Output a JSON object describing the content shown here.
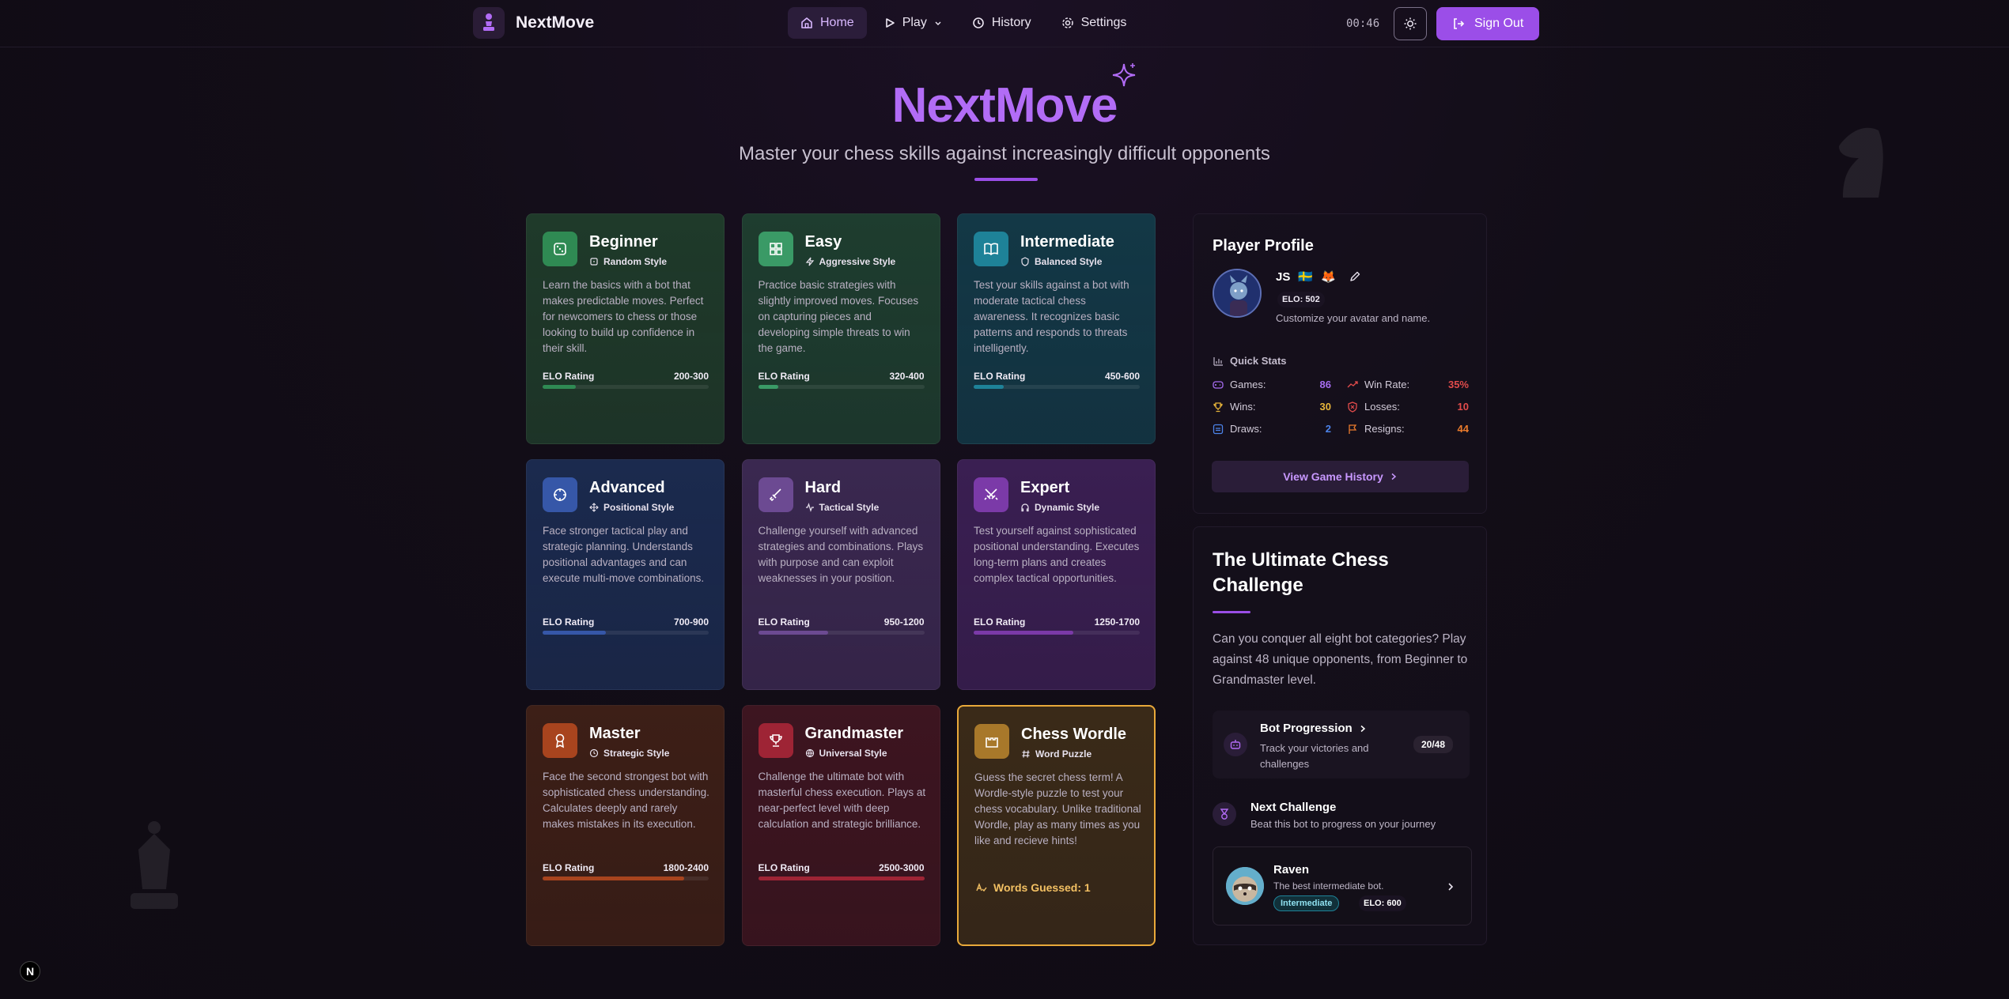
{
  "nav": {
    "brand": "NextMove",
    "links": [
      {
        "label": "Home",
        "active": true
      },
      {
        "label": "Play",
        "has_dropdown": true
      },
      {
        "label": "History"
      },
      {
        "label": "Settings"
      }
    ],
    "timer": "00:46",
    "theme_icon": "sun-icon",
    "signout_label": "Sign Out"
  },
  "hero": {
    "title": "NextMove",
    "subtitle": "Master your chess skills against increasingly difficult opponents"
  },
  "elo_label": "ELO Rating",
  "cards": [
    {
      "title": "Beginner",
      "style": "Random Style",
      "icon": "dice-icon",
      "style_icon": "dice-small-icon",
      "description": "Learn the basics with a bot that makes predictable moves. Perfect for newcomers to chess or those looking to build up confidence in their skill.",
      "elo": "200-300",
      "progress": 0.2,
      "color": "#1f3a2a",
      "accent": "#2f8a53"
    },
    {
      "title": "Easy",
      "style": "Aggressive Style",
      "icon": "blocks-icon",
      "style_icon": "zap-icon",
      "description": "Practice basic strategies with slightly improved moves. Focuses on capturing pieces and developing simple threats to win the game.",
      "elo": "320-400",
      "progress": 0.12,
      "color": "#1e3d2f",
      "accent": "#3a9a66"
    },
    {
      "title": "Intermediate",
      "style": "Balanced Style",
      "icon": "book-icon",
      "style_icon": "shield-icon",
      "description": "Test your skills against a bot with moderate tactical chess awareness. It recognizes basic patterns and responds to threats intelligently.",
      "elo": "450-600",
      "progress": 0.18,
      "color": "#133846",
      "accent": "#1e8298"
    },
    {
      "title": "Advanced",
      "style": "Positional Style",
      "icon": "crosshair-icon",
      "style_icon": "move-icon",
      "description": "Face stronger tactical play and strategic planning. Understands positional advantages and can execute multi-move combinations.",
      "elo": "700-900",
      "progress": 0.38,
      "color": "#1b2a4e",
      "accent": "#3657a8"
    },
    {
      "title": "Hard",
      "style": "Tactical Style",
      "icon": "sword-icon",
      "style_icon": "activity-icon",
      "description": "Challenge yourself with advanced strategies and combinations. Plays with purpose and can exploit weaknesses in your position.",
      "elo": "950-1200",
      "progress": 0.42,
      "color": "#3a2850",
      "accent": "#6c4a92"
    },
    {
      "title": "Expert",
      "style": "Dynamic Style",
      "icon": "swords-icon",
      "style_icon": "headphones-icon",
      "description": "Test yourself against sophisticated positional understanding. Executes long-term plans and creates complex tactical opportunities.",
      "elo": "1250-1700",
      "progress": 0.6,
      "color": "#3a1f52",
      "accent": "#7b3aa8"
    },
    {
      "title": "Master",
      "style": "Strategic Style",
      "icon": "award-icon",
      "style_icon": "clock-icon",
      "description": "Face the second strongest bot with sophisticated chess understanding. Calculates deeply and rarely makes mistakes in its execution.",
      "elo": "1800-2400",
      "progress": 0.85,
      "color": "#3d1f17",
      "accent": "#a8441e"
    },
    {
      "title": "Grandmaster",
      "style": "Universal Style",
      "icon": "trophy-icon",
      "style_icon": "globe-icon",
      "description": "Challenge the ultimate bot with masterful chess execution. Plays at near-perfect level with deep calculation and strategic brilliance.",
      "elo": "2500-3000",
      "progress": 1.0,
      "color": "#3d1520",
      "accent": "#9e2435"
    },
    {
      "title": "Chess Wordle",
      "style": "Word Puzzle",
      "icon": "castle-icon",
      "style_icon": "hash-icon",
      "description": "Guess the secret chess term! A Wordle-style puzzle to test your chess vocabulary. Unlike traditional Wordle, play as many times as you like and recieve hints!",
      "words_guessed": "Words Guessed: 1",
      "color": "#3a2a18",
      "accent": "#a8782a"
    }
  ],
  "profile": {
    "heading": "Player Profile",
    "name": "JS",
    "flag": "🇸🇪",
    "emoji": "🦊",
    "elo": "ELO: 502",
    "caption": "Customize your avatar and name.",
    "quick_stats_label": "Quick Stats",
    "stats": [
      {
        "label": "Games:",
        "value": "86",
        "icon": "gamepad-icon",
        "color": "#a66cf0"
      },
      {
        "label": "Win Rate:",
        "value": "35%",
        "icon": "trending-up-icon",
        "color": "#e14b4b"
      },
      {
        "label": "Wins:",
        "value": "30",
        "icon": "trophy-icon",
        "color": "#e8b53a"
      },
      {
        "label": "Losses:",
        "value": "10",
        "icon": "shield-x-icon",
        "color": "#e14b4b"
      },
      {
        "label": "Draws:",
        "value": "2",
        "icon": "equal-icon",
        "color": "#4c83ea"
      },
      {
        "label": "Resigns:",
        "value": "44",
        "icon": "flag-icon",
        "color": "#ea7b2c"
      }
    ],
    "history_button": "View Game History"
  },
  "challenge": {
    "title": "The Ultimate Chess Challenge",
    "description": "Can you conquer all eight bot categories? Play against 48 unique opponents, from Beginner to Grandmaster level.",
    "progression_title": "Bot Progression",
    "progression_sub": "Track your victories and challenges",
    "progression_count": "20/48",
    "next_title": "Next Challenge",
    "next_sub": "Beat this bot to progress on your journey",
    "bot_name": "Raven",
    "bot_desc": "The best intermediate bot.",
    "bot_tier": "Intermediate",
    "bot_elo": "ELO: 600"
  },
  "dev_badge": "N"
}
